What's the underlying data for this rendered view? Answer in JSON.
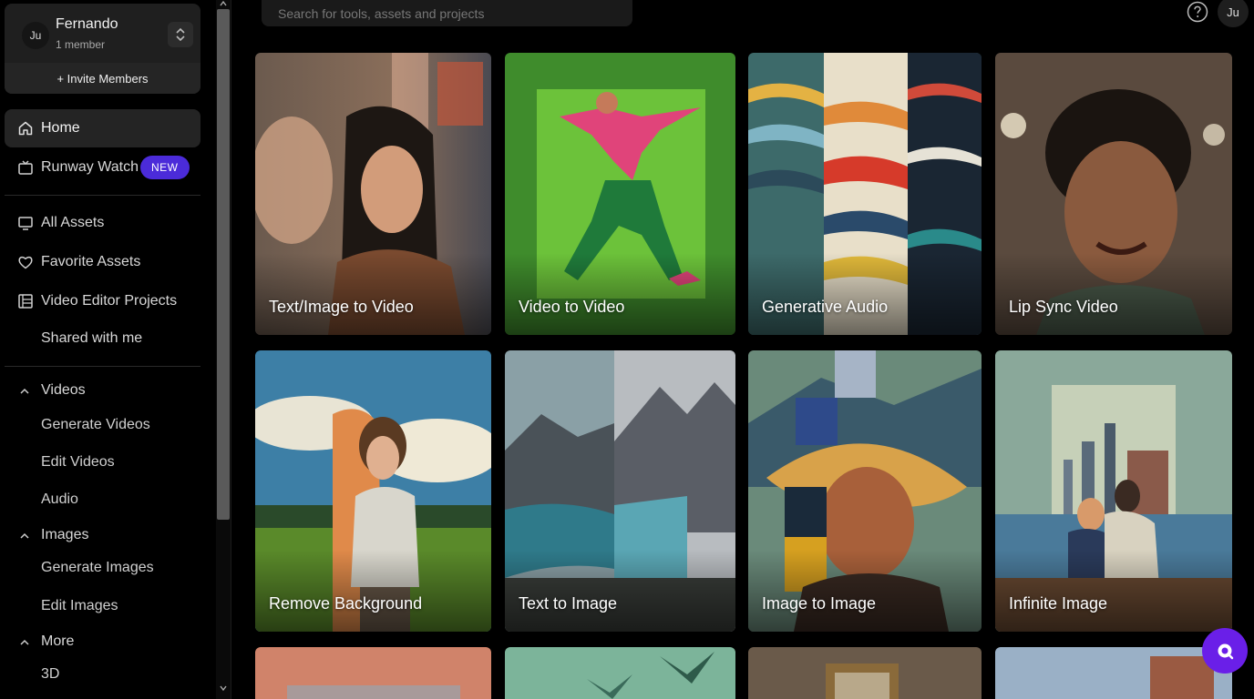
{
  "team": {
    "avatar": "Ju",
    "name": "Fernando",
    "members": "1 member",
    "invite_label": "+ Invite Members"
  },
  "nav": {
    "home": "Home",
    "watch": "Runway Watch",
    "watch_badge": "NEW",
    "all_assets": "All Assets",
    "favorite_assets": "Favorite Assets",
    "video_editor_projects": "Video Editor Projects",
    "shared": "Shared with me"
  },
  "sections": {
    "videos": {
      "label": "Videos",
      "items": [
        "Generate Videos",
        "Edit Videos",
        "Audio"
      ]
    },
    "images": {
      "label": "Images",
      "items": [
        "Generate Images",
        "Edit Images"
      ]
    },
    "more": {
      "label": "More",
      "items": [
        "3D"
      ]
    }
  },
  "header": {
    "search_placeholder": "Search for tools, assets and projects",
    "user_initials": "Ju"
  },
  "cards": [
    {
      "label": "Text/Image to Video"
    },
    {
      "label": "Video to Video"
    },
    {
      "label": "Generative Audio"
    },
    {
      "label": "Lip Sync Video"
    },
    {
      "label": "Remove Background"
    },
    {
      "label": "Text to Image"
    },
    {
      "label": "Image to Image"
    },
    {
      "label": "Infinite Image"
    }
  ],
  "colors": {
    "accent": "#4b2bd9",
    "fab": "#6a1fe8"
  }
}
